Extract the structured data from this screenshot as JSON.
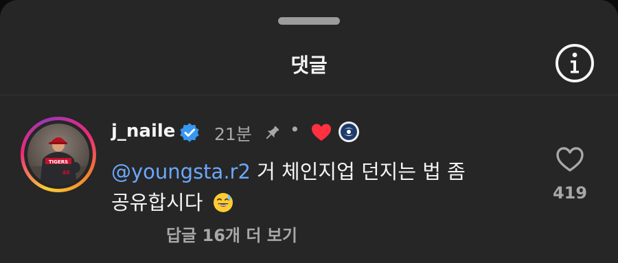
{
  "sheet": {
    "title": "댓글"
  },
  "comment": {
    "username": "j_naile",
    "time": "21분",
    "separator": "•",
    "mention": "@youngsta.r2",
    "text_line1": " 거 체인지업 던지는 법 좀",
    "text_line2": "공유합시다",
    "emoji": "😅",
    "replies_label": "답글 16개 더 보기",
    "like_count": "419",
    "jersey_text": "TIGERS",
    "jersey_number": "40"
  },
  "icons": {
    "info": "info-circle-icon",
    "verified": "verified-badge-icon",
    "pin": "pin-icon",
    "liked_by_author": "red-heart-icon",
    "team_badge": "team-logo-icon",
    "like": "heart-outline-icon"
  },
  "colors": {
    "sheet_bg": "#262626",
    "mention": "#6ba8ff",
    "verified": "#3897f0",
    "heart": "#ff3040",
    "muted": "#a8a8a8"
  }
}
